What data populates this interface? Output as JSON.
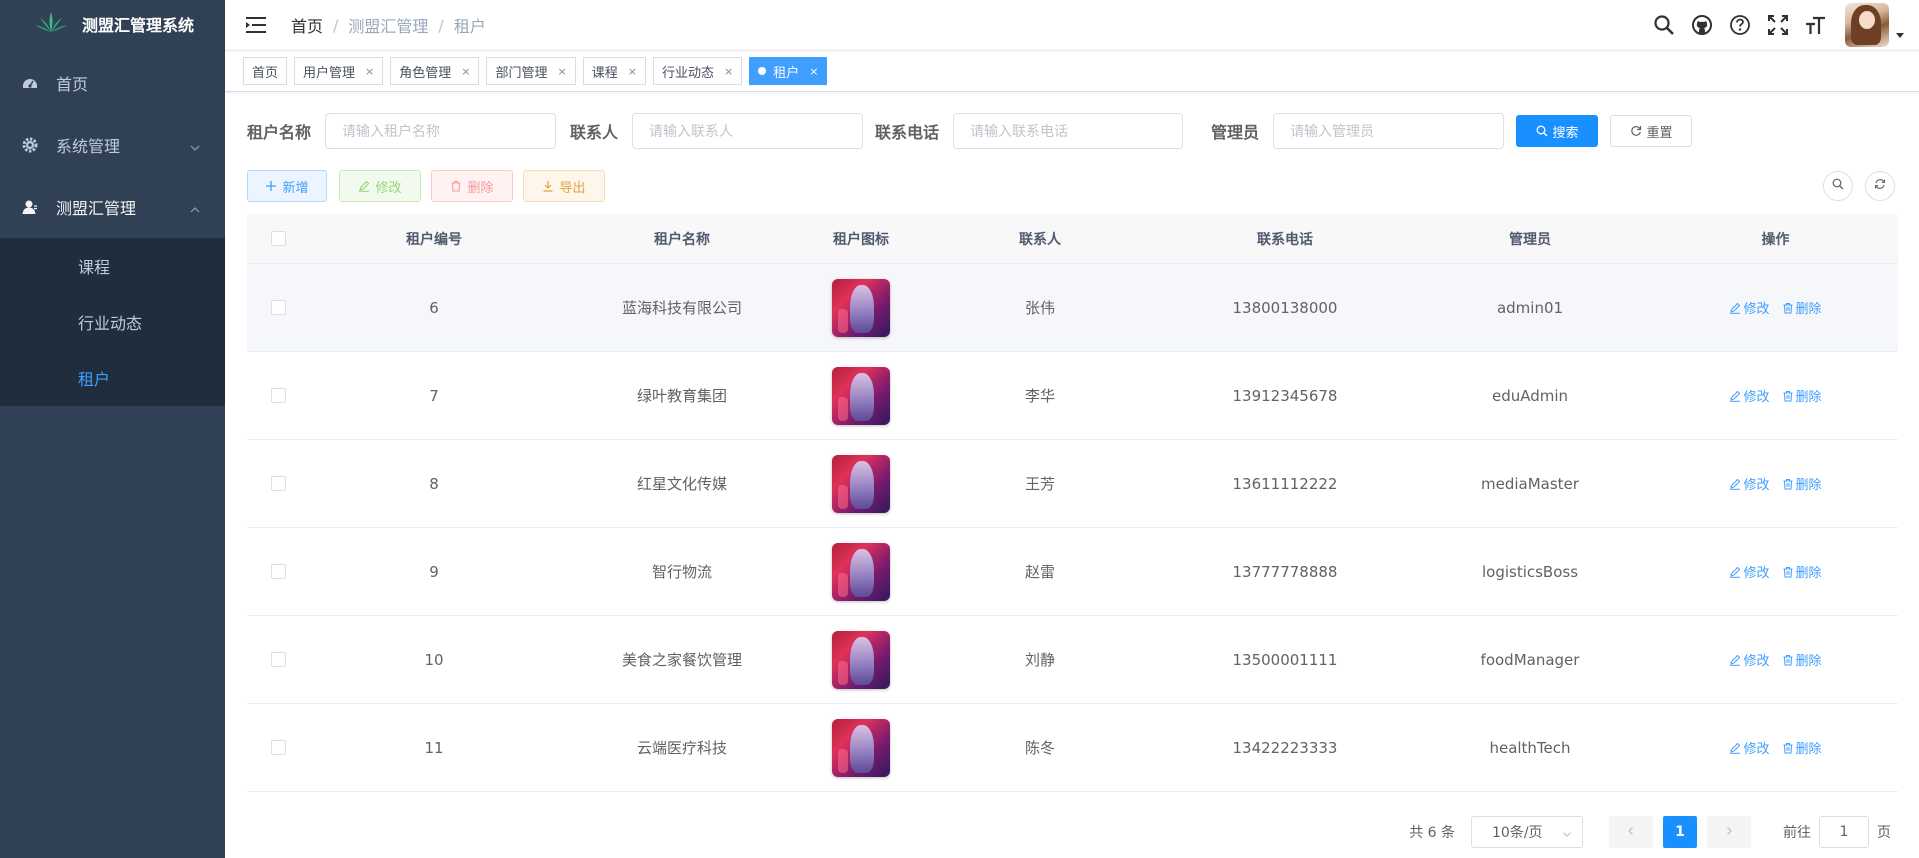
{
  "app": {
    "title": "测盟汇管理系统"
  },
  "sidebar": {
    "items": [
      {
        "label": "首页",
        "icon": "dashboard-icon"
      },
      {
        "label": "系统管理",
        "icon": "gear-icon"
      },
      {
        "label": "测盟汇管理",
        "icon": "user-icon"
      }
    ],
    "sub_items": [
      {
        "label": "课程"
      },
      {
        "label": "行业动态"
      },
      {
        "label": "租户",
        "active": true
      }
    ],
    "active_color": "#409eff",
    "bg_color": "#304156"
  },
  "header": {
    "breadcrumb": [
      "首页",
      "测盟汇管理",
      "租户"
    ],
    "separator": "/"
  },
  "tags": [
    {
      "label": "首页",
      "closable": false
    },
    {
      "label": "用户管理",
      "closable": true
    },
    {
      "label": "角色管理",
      "closable": true
    },
    {
      "label": "部门管理",
      "closable": true
    },
    {
      "label": "课程",
      "closable": true
    },
    {
      "label": "行业动态",
      "closable": true
    },
    {
      "label": "租户",
      "closable": true,
      "active": true
    }
  ],
  "close_glyph": "×",
  "search": {
    "tenant_name_label": "租户名称",
    "tenant_name_placeholder": "请输入租户名称",
    "contact_label": "联系人",
    "contact_placeholder": "请输入联系人",
    "phone_label": "联系电话",
    "phone_placeholder": "请输入联系电话",
    "admin_label": "管理员",
    "admin_placeholder": "请输入管理员",
    "search_button": "搜索",
    "reset_button": "重置"
  },
  "toolbar": {
    "add": "新增",
    "edit": "修改",
    "delete": "删除",
    "export": "导出"
  },
  "table": {
    "columns": [
      "租户编号",
      "租户名称",
      "租户图标",
      "联系人",
      "联系电话",
      "管理员",
      "操作"
    ],
    "rows": [
      {
        "id": "6",
        "name": "蓝海科技有限公司",
        "contact": "张伟",
        "phone": "13800138000",
        "admin": "admin01"
      },
      {
        "id": "7",
        "name": "绿叶教育集团",
        "contact": "李华",
        "phone": "13912345678",
        "admin": "eduAdmin"
      },
      {
        "id": "8",
        "name": "红星文化传媒",
        "contact": "王芳",
        "phone": "13611112222",
        "admin": "mediaMaster"
      },
      {
        "id": "9",
        "name": "智行物流",
        "contact": "赵雷",
        "phone": "13777778888",
        "admin": "logisticsBoss"
      },
      {
        "id": "10",
        "name": "美食之家餐饮管理",
        "contact": "刘静",
        "phone": "13500001111",
        "admin": "foodManager"
      },
      {
        "id": "11",
        "name": "云端医疗科技",
        "contact": "陈冬",
        "phone": "13422223333",
        "admin": "healthTech"
      }
    ],
    "op_edit": "修改",
    "op_delete": "删除"
  },
  "pagination": {
    "total_text": "共 6 条",
    "page_size": "10条/页",
    "current_page": "1",
    "goto_prefix": "前往",
    "goto_value": "1",
    "goto_suffix": "页"
  }
}
